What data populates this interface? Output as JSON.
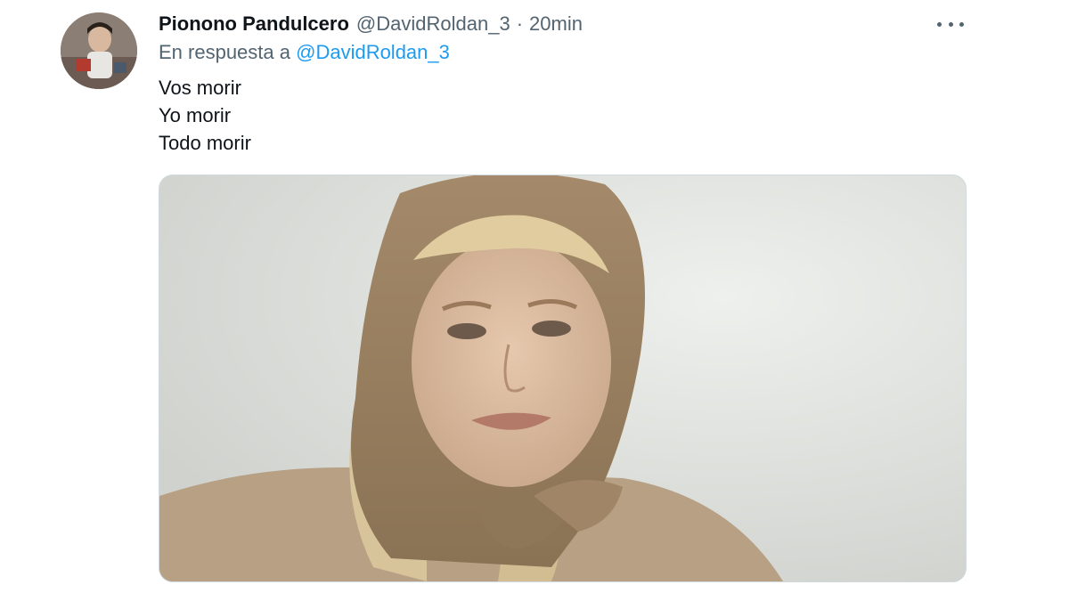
{
  "tweet": {
    "display_name": "Piono​no Pandulcero",
    "handle": "@DavidRoldan_3",
    "separator": "·",
    "time": "20min",
    "reply_prefix": "En respuesta a",
    "reply_to": "@DavidRoldan_3",
    "lines": [
      "Vos morir",
      "Yo morir",
      "Todo morir"
    ],
    "more_icon": "more-horizontal-icon"
  }
}
